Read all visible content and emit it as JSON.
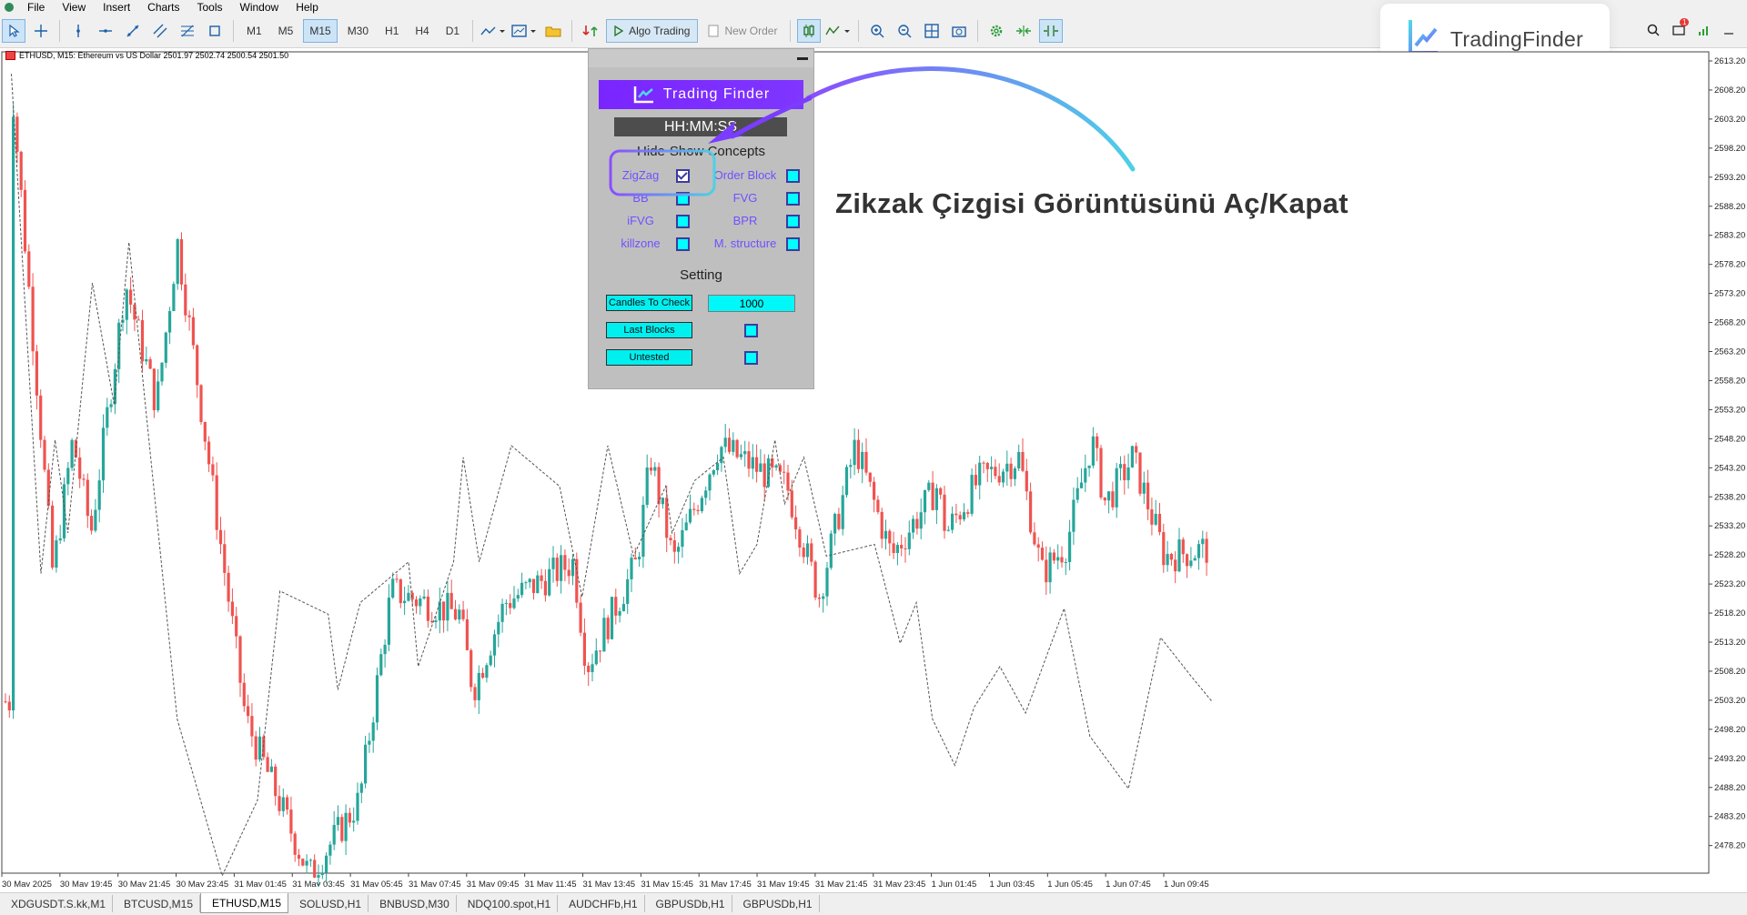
{
  "menu": [
    "File",
    "View",
    "Insert",
    "Charts",
    "Tools",
    "Window",
    "Help"
  ],
  "toolbar": {
    "timeframes": [
      "M1",
      "M5",
      "M15",
      "M30",
      "H1",
      "H4",
      "D1"
    ],
    "active_timeframe": "M15",
    "algo_trading": "Algo Trading",
    "new_order": "New Order"
  },
  "notification_count": "1",
  "logo": {
    "brand": "TradingFinder"
  },
  "chart": {
    "title": "ETHUSD, M15:  Ethereum vs US Dollar  2501.97 2502.74 2500.54 2501.50",
    "price_labels": [
      "2613.20",
      "2608.20",
      "2603.20",
      "2598.20",
      "2593.20",
      "2588.20",
      "2583.20",
      "2578.20",
      "2573.20",
      "2568.20",
      "2563.20",
      "2558.20",
      "2553.20",
      "2548.20",
      "2543.20",
      "2538.20",
      "2533.20",
      "2528.20",
      "2523.20",
      "2518.20",
      "2513.20",
      "2508.20",
      "2503.20",
      "2498.20",
      "2493.20",
      "2488.20",
      "2483.20",
      "2478.20"
    ],
    "time_labels": [
      "30 May 2025",
      "30 May 19:45",
      "30 May 21:45",
      "30 May 23:45",
      "31 May 01:45",
      "31 May 03:45",
      "31 May 05:45",
      "31 May 07:45",
      "31 May 09:45",
      "31 May 11:45",
      "31 May 13:45",
      "31 May 15:45",
      "31 May 17:45",
      "31 May 19:45",
      "31 May 21:45",
      "31 May 23:45",
      "1 Jun 01:45",
      "1 Jun 03:45",
      "1 Jun 05:45",
      "1 Jun 07:45",
      "1 Jun 09:45"
    ]
  },
  "panel": {
    "banner": "Trading Finder",
    "clock": "HH:MM:SS",
    "concepts_title": "Hide-Show Concepts",
    "options": [
      {
        "label": "ZigZag",
        "checked": true
      },
      {
        "label": "Order Block",
        "checked": false
      },
      {
        "label": "BB",
        "checked": false
      },
      {
        "label": "FVG",
        "checked": false
      },
      {
        "label": "iFVG",
        "checked": false
      },
      {
        "label": "BPR",
        "checked": false
      },
      {
        "label": "killzone",
        "checked": false
      },
      {
        "label": "M. structure",
        "checked": false
      }
    ],
    "setting_title": "Setting",
    "candles_to_check_label": "Candles To Check",
    "candles_to_check_value": "1000",
    "last_blocks_label": "Last Blocks",
    "untested_label": "Untested"
  },
  "annotation": "Zikzak Çizgisi Görüntüsünü Aç/Kapat",
  "tabs": [
    "XDGUSDT.S.kk,M1",
    "BTCUSD,M15",
    "ETHUSD,M15",
    "SOLUSD,H1",
    "BNBUSD,M30",
    "NDQ100.spot,H1",
    "AUDCHFb,H1",
    "GBPUSDb,H1",
    "GBPUSDb,H1"
  ],
  "active_tab": "ETHUSD,M15",
  "colors": {
    "bull": "#26a69a",
    "bear": "#ef5350",
    "accent": "#7a25ff",
    "cyan": "#00f0f0"
  }
}
